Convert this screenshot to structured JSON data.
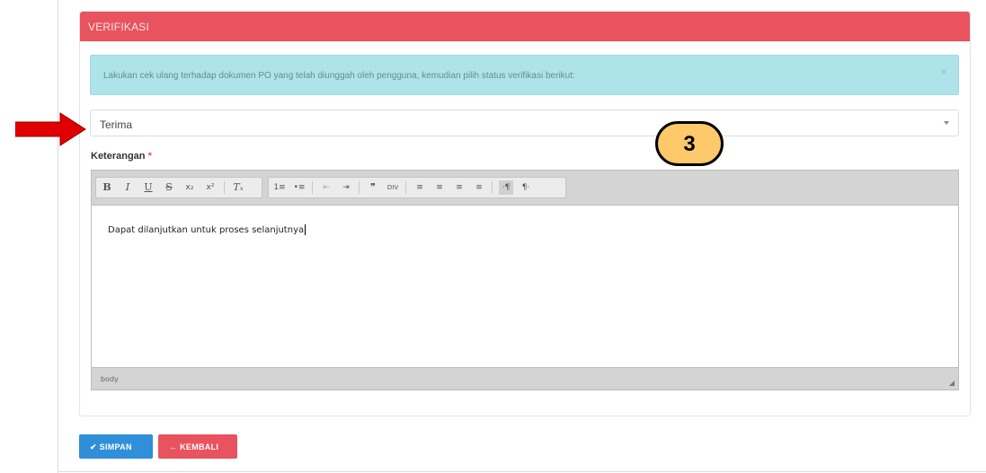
{
  "panel": {
    "title": "VERIFIKASI",
    "header_color": "#e8535f"
  },
  "alert": {
    "text": "Lakukan cek ulang terhadap dokumen PO yang telah diunggah oleh pengguna, kemudian pilih status verifikasi berikut:",
    "close_glyph": "×"
  },
  "status_select": {
    "value": "Terima"
  },
  "keterangan": {
    "label": "Keterangan",
    "required_mark": "*"
  },
  "editor": {
    "toolbar": {
      "bold": "B",
      "italic": "I",
      "underline": "U",
      "strike": "S",
      "subscript": "x₂",
      "superscript": "x²",
      "remove_format": "Tₓ",
      "numbered_list": "1≡",
      "bulleted_list": "•≡",
      "outdent": "⇤",
      "indent": "⇥",
      "blockquote": "❞",
      "div": "DIV",
      "align_left": "≡",
      "align_center": "≡",
      "align_right": "≡",
      "justify": "≡",
      "ltr": "·¶",
      "rtl": "¶·"
    },
    "content": "Dapat dilanjutkan untuk proses selanjutnya",
    "status_path": "body"
  },
  "actions": {
    "save_label": "✔ SIMPAN",
    "back_label": "← KEMBALI",
    "save_color": "#2f8fd8",
    "back_color": "#e8535f"
  },
  "annotation": {
    "step_number": "3",
    "badge_color": "#fdc96a",
    "arrow_color": "#e00000"
  }
}
